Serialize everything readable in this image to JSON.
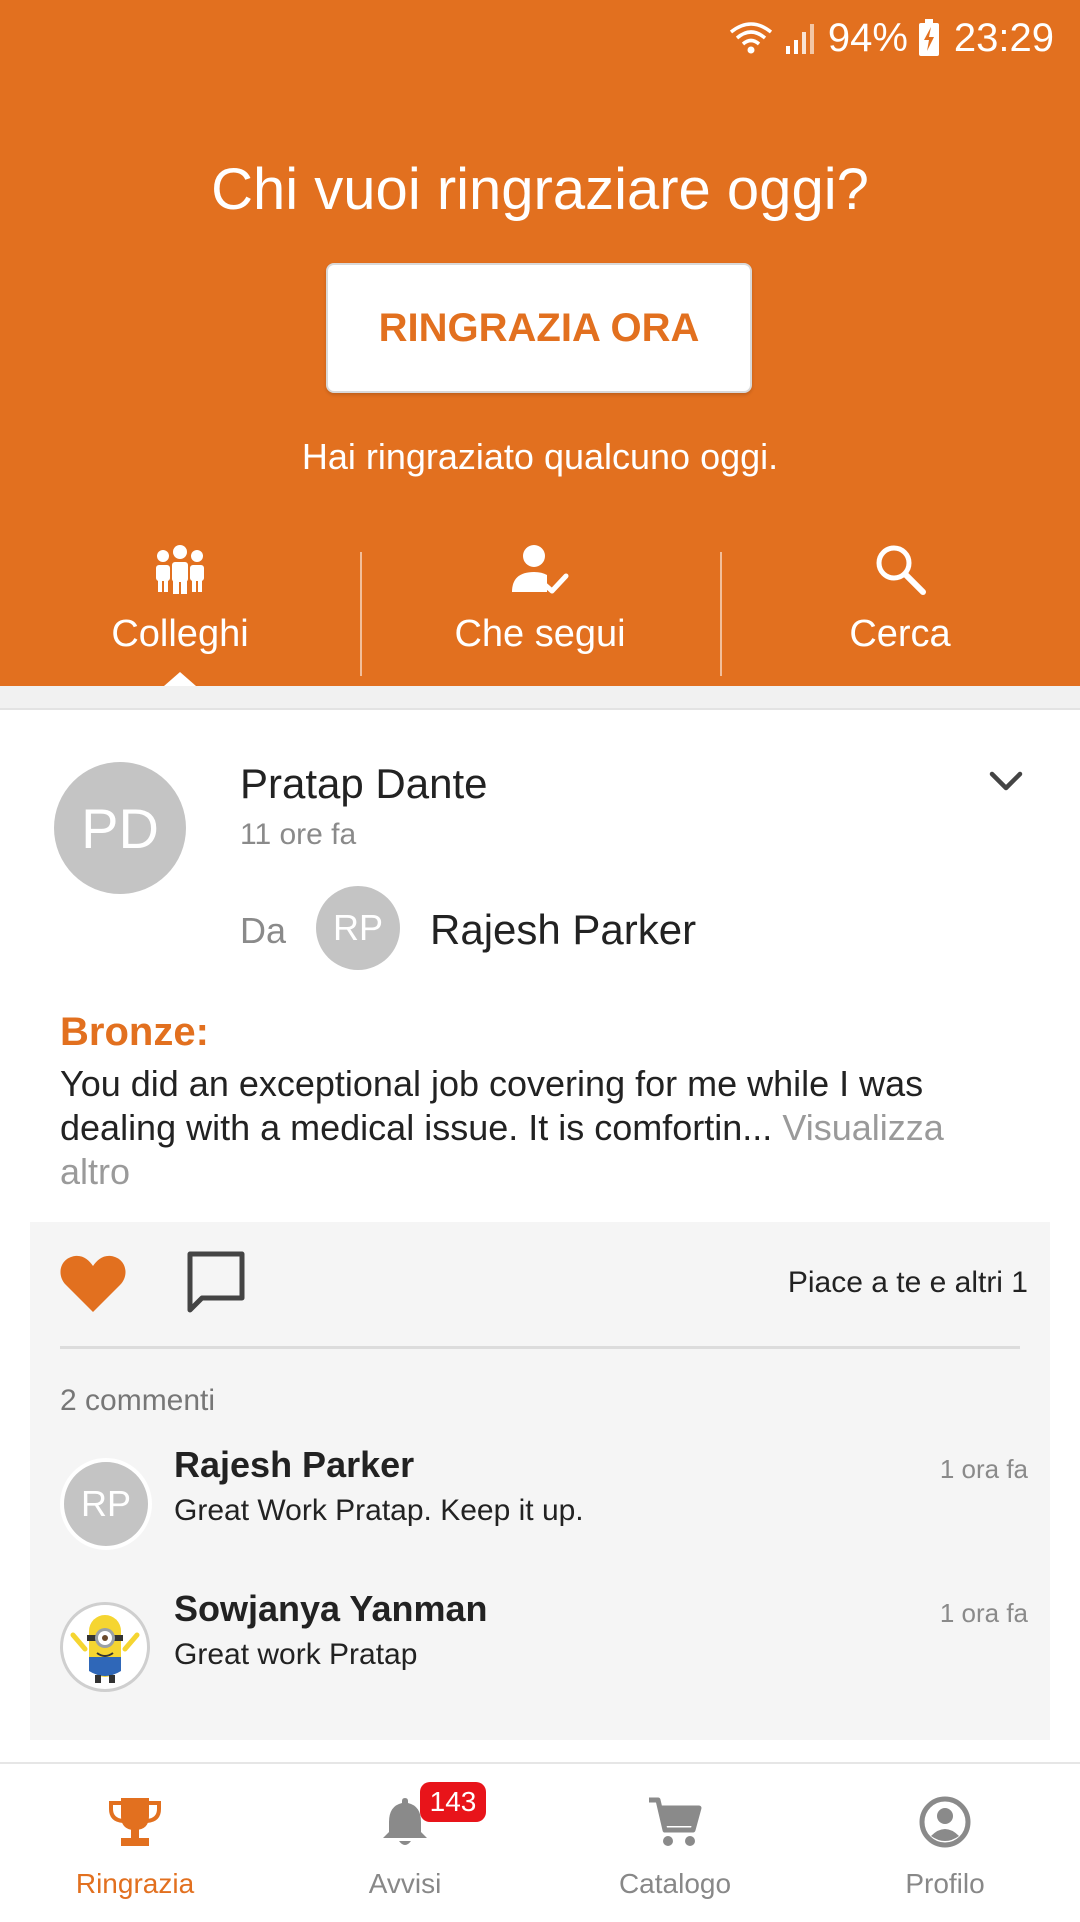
{
  "status_bar": {
    "battery": "94%",
    "time": "23:29"
  },
  "header": {
    "title": "Chi vuoi ringraziare oggi?",
    "cta_label": "RINGRAZIA ORA",
    "subtitle": "Hai ringraziato qualcuno oggi.",
    "tabs": [
      {
        "label": "Colleghi",
        "icon": "team-icon",
        "selected": true
      },
      {
        "label": "Che segui",
        "icon": "person-check-icon",
        "selected": false
      },
      {
        "label": "Cerca",
        "icon": "search-icon",
        "selected": false
      }
    ]
  },
  "post": {
    "recipient_initials": "PD",
    "recipient_name": "Pratap Dante",
    "time": "11 ore fa",
    "from_label": "Da",
    "sender_initials": "RP",
    "sender_name": "Rajesh Parker",
    "badge": "Bronze:",
    "message": "You did an exceptional job covering for me while I was dealing with a medical issue. It is comfortin...",
    "see_more": "Visualizza altro",
    "likes_text": "Piace a te e altri 1",
    "comments_count": "2 commenti",
    "comments": [
      {
        "initials": "RP",
        "author": "Rajesh Parker",
        "text": "Great Work Pratap. Keep it up.",
        "time": "1 ora fa"
      },
      {
        "initials": "",
        "author": "Sowjanya Yanman",
        "text": "Great work Pratap",
        "time": "1 ora fa"
      }
    ]
  },
  "bottom_nav": {
    "items": [
      {
        "label": "Ringrazia",
        "icon": "trophy-icon",
        "active": true
      },
      {
        "label": "Avvisi",
        "icon": "bell-icon",
        "active": false,
        "badge": "143"
      },
      {
        "label": "Catalogo",
        "icon": "cart-icon",
        "active": false
      },
      {
        "label": "Profilo",
        "icon": "profile-icon",
        "active": false
      }
    ]
  },
  "colors": {
    "accent": "#e2701f",
    "badge_red": "#e8141a",
    "inactive_gray": "#888888"
  }
}
